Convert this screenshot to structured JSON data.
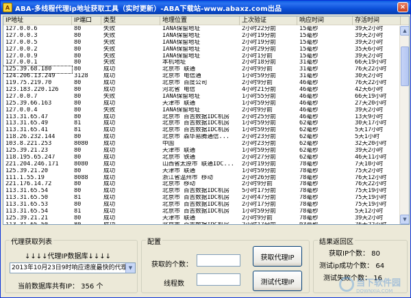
{
  "window": {
    "title": "ABA-多线程代理ip地址获取工具（实时更新）-ABA下载站-www.abaxz.com出品",
    "close_glyph": "×",
    "app_icon_glyph": "A"
  },
  "table": {
    "columns": [
      "IP地址",
      "IP端口",
      "类型",
      "地理位置",
      "上次验证",
      "响应时间",
      "存活时间"
    ],
    "rows": [
      [
        "127.0.0.6",
        "80",
        "失败",
        "IANA保留地址",
        "2小时22分前",
        "15毫秒",
        "39天2小时"
      ],
      [
        "127.0.0.3",
        "80",
        "失败",
        "IANA保留地址",
        "2小时19分前",
        "15毫秒",
        "39天2小时"
      ],
      [
        "127.0.0.5",
        "80",
        "失败",
        "IANA保留地址",
        "2小时19分前",
        "15毫秒",
        "39天2小时"
      ],
      [
        "127.0.0.2",
        "80",
        "失败",
        "IANA保留地址",
        "2小时29分前",
        "15毫秒",
        "35天6小时"
      ],
      [
        "127.0.0.9",
        "80",
        "失败",
        "IANA保留地址",
        "2小时1分前",
        "15毫秒",
        "39天2小时"
      ],
      [
        "127.0.0.1",
        "80",
        "失败",
        "本机地址",
        "2小时18分前",
        "31毫秒",
        "66天19小时"
      ],
      [
        "125.39.68.180",
        "80",
        "成功",
        "北京市 联通",
        "2小时9分前",
        "31毫秒",
        "76天22小时"
      ],
      [
        "124.206.13.249",
        "3128",
        "成功",
        "北京市 电信通",
        "1小时59分前",
        "31毫秒",
        "30天2小时"
      ],
      [
        "119.75.219.70",
        "80",
        "成功",
        "北京市 百度公司",
        "2小时9分前",
        "46毫秒",
        "76天22小时"
      ],
      [
        "123.183.220.126",
        "80",
        "成功",
        "河北省 电信",
        "4小时21分前",
        "46毫秒",
        "42天6小时"
      ],
      [
        "127.0.0.7",
        "80",
        "失败",
        "IANA保留地址",
        "1小时55分前",
        "46毫秒",
        "66天19小时"
      ],
      [
        "125.39.66.163",
        "80",
        "成功",
        "天津市 联通",
        "1小时59分前",
        "46毫秒",
        "27天20小时"
      ],
      [
        "127.0.0.4",
        "80",
        "失败",
        "IANA保留地址",
        "2小时9分前",
        "46毫秒",
        "39天2小时"
      ],
      [
        "113.31.65.47",
        "80",
        "成功",
        "北京市 百吉数据IDC机房",
        "2小时25分前",
        "46毫秒",
        "13天9小时"
      ],
      [
        "113.31.65.49",
        "81",
        "成功",
        "北京市 百吉数据IDC机房",
        "1小时59分前",
        "62毫秒",
        "30天17小时"
      ],
      [
        "113.31.65.41",
        "81",
        "成功",
        "北京市 百吉数据IDC机房",
        "1小时59分前",
        "62毫秒",
        "5天17小时"
      ],
      [
        "118.26.232.144",
        "80",
        "成功",
        "北京市 森华易腾通信...",
        "2小时23分前",
        "62毫秒",
        "5天1小时"
      ],
      [
        "103.8.221.253",
        "8080",
        "成功",
        "中国",
        "2小时23分前",
        "62毫秒",
        "32天20小时"
      ],
      [
        "125.39.21.23",
        "80",
        "成功",
        "天津市 联通",
        "1小时59分前",
        "62毫秒",
        "39天2小时"
      ],
      [
        "118.195.65.247",
        "80",
        "成功",
        "北京市 铁通",
        "2小时27分前",
        "62毫秒",
        "46天11小时"
      ],
      [
        "221.204.246.171",
        "8080",
        "成功",
        "山西省太原市 联通IDC...",
        "2小时19分前",
        "78毫秒",
        "7天10小时"
      ],
      [
        "125.39.21.20",
        "80",
        "成功",
        "天津市 联通",
        "1小时59分前",
        "78毫秒",
        "75天2小时"
      ],
      [
        "111.1.55.19",
        "8088",
        "成功",
        "浙江省温州市 移动",
        "2小时26分前",
        "78毫秒",
        "76天12小时"
      ],
      [
        "221.176.14.72",
        "80",
        "成功",
        "北京市 移动",
        "2小时9分前",
        "78毫秒",
        "76天22小时"
      ],
      [
        "113.31.65.54",
        "80",
        "成功",
        "北京市 百吉数据IDC机房",
        "5小时17分前",
        "78毫秒",
        "75天19小时"
      ],
      [
        "113.31.65.50",
        "81",
        "成功",
        "北京市 百吉数据IDC机房",
        "2小时47分前",
        "78毫秒",
        "75天19小时"
      ],
      [
        "113.31.65.53",
        "80",
        "成功",
        "北京市 百吉数据IDC机房",
        "2小时17分前",
        "78毫秒",
        "75天19小时"
      ],
      [
        "113.31.65.54",
        "81",
        "成功",
        "北京市 百吉数据IDC机房",
        "1小时59分前",
        "78毫秒",
        "5天12小时"
      ],
      [
        "125.39.21.21",
        "80",
        "成功",
        "天津市 联通",
        "2小时9分前",
        "78毫秒",
        "39天2小时"
      ],
      [
        "113.31.65.50",
        "80",
        "成功",
        "北京市 百吉数据IDC机房",
        "2小时17分前",
        "93毫秒",
        "76天22小时"
      ]
    ],
    "scroll_up_glyph": "▲",
    "scroll_down_glyph": "▼"
  },
  "proxy_list": {
    "title": "代理获取列表",
    "db_label": "↓↓↓↓代理IP数据库↓↓↓↓",
    "combo_value": "2013年10月23日9时响应速度最快的代理",
    "combo_arrow": "▼",
    "db_count_label": "当前数据库共有IP：",
    "db_count": "356",
    "db_count_unit": "个"
  },
  "config": {
    "title": "配置",
    "count_label": "获取的个数：",
    "count_value": "",
    "threads_label": "线程数",
    "threads_value": "",
    "get_button": "获取代理IP",
    "test_button": "测试代理IP"
  },
  "results": {
    "title": "结果返回区",
    "ip_count_label": "获取IP个数：",
    "ip_count": "80",
    "success_label": "测试ip成功个数：",
    "success_count": "64",
    "fail_label": "测试失败个数：",
    "fail_count": "16"
  },
  "watermark": {
    "text": "当下软件园",
    "sub": "DOWNXIA.COM"
  }
}
